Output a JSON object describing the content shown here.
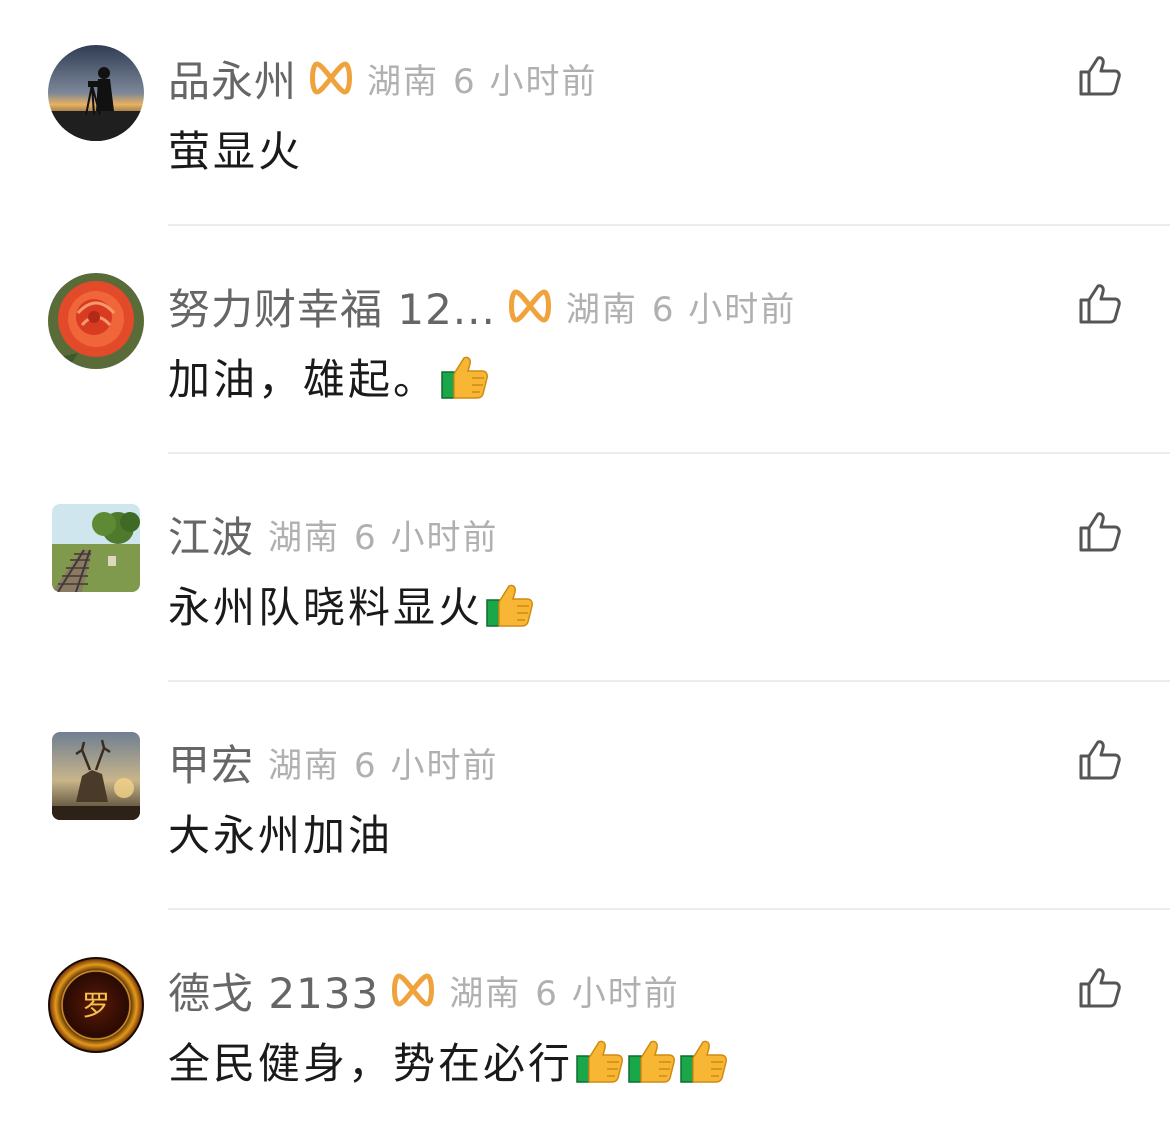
{
  "comments": [
    {
      "username": "品永州",
      "vip": true,
      "location": "湖南",
      "time": "6 小时前",
      "text": "萤显火",
      "thumbs_emoji_count": 0
    },
    {
      "username": "努力财幸福 12...",
      "vip": true,
      "location": "湖南",
      "time": "6 小时前",
      "text": "加油，雄起。",
      "thumbs_emoji_count": 1
    },
    {
      "username": "江波",
      "vip": false,
      "location": "湖南",
      "time": "6 小时前",
      "text": "永州队晓料显火",
      "thumbs_emoji_count": 1
    },
    {
      "username": "甲宏",
      "vip": false,
      "location": "湖南",
      "time": "6 小时前",
      "text": "大永州加油",
      "thumbs_emoji_count": 0
    },
    {
      "username": "德戈 2133",
      "vip": true,
      "location": "湖南",
      "time": "6 小时前",
      "text": "全民健身，势在必行",
      "thumbs_emoji_count": 3,
      "avatar_text": "罗"
    }
  ],
  "colors": {
    "username": "#666666",
    "meta": "#b0b0b0",
    "text": "#1a1a1a",
    "vip": "#f0a33c",
    "divider": "#ececec",
    "like_icon": "#555555"
  },
  "icons": {
    "like": "thumbs-up-outline-icon",
    "vip": "vip-badge-icon",
    "emoji": "thumbs-up-emoji-icon"
  }
}
